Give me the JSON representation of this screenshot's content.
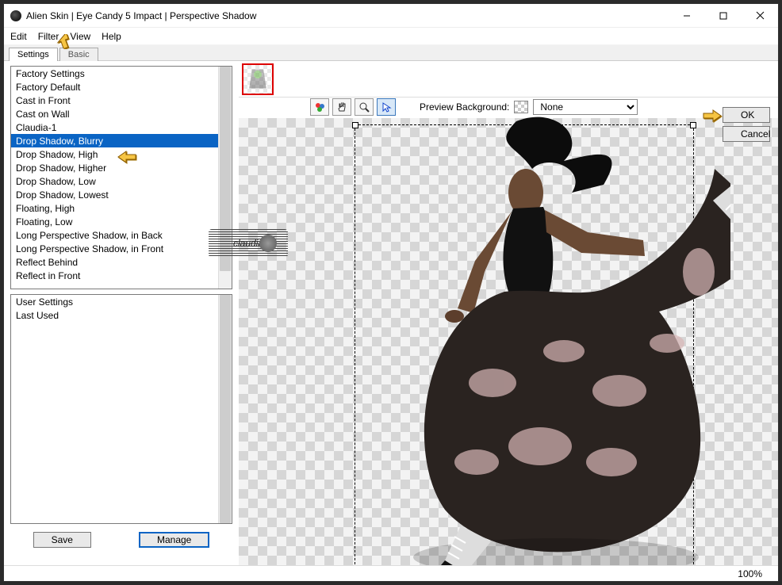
{
  "window": {
    "title": "Alien Skin | Eye Candy 5 Impact | Perspective Shadow"
  },
  "menubar": {
    "edit": "Edit",
    "filter": "Filter",
    "view": "View",
    "help": "Help"
  },
  "tabs": {
    "settings": "Settings",
    "basic": "Basic"
  },
  "factory": {
    "header": "Factory Settings",
    "items": [
      "Factory Default",
      "Cast in Front",
      "Cast on Wall",
      "Claudia-1",
      "Drop Shadow, Blurry",
      "Drop Shadow, High",
      "Drop Shadow, Higher",
      "Drop Shadow, Low",
      "Drop Shadow, Lowest",
      "Floating, High",
      "Floating, Low",
      "Long Perspective Shadow, in Back",
      "Long Perspective Shadow, in Front",
      "Reflect Behind",
      "Reflect in Front"
    ],
    "selected": "Drop Shadow, Blurry"
  },
  "user": {
    "header": "User Settings",
    "items": [
      "Last Used"
    ]
  },
  "buttons": {
    "save": "Save",
    "manage": "Manage",
    "ok": "OK",
    "cancel": "Cancel"
  },
  "preview": {
    "label": "Preview Background:",
    "value": "None"
  },
  "status": {
    "zoom": "100%"
  },
  "watermark": "claudia"
}
